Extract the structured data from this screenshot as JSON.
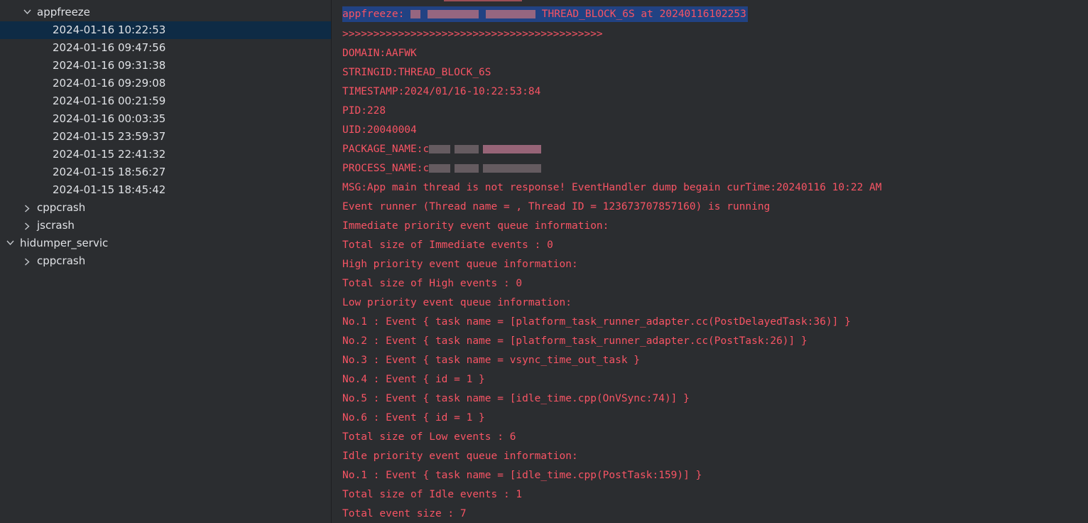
{
  "tree": {
    "partial_top_label": "…",
    "folder": "appfreeze",
    "entries": [
      "2024-01-16 10:22:53",
      "2024-01-16 09:47:56",
      "2024-01-16 09:31:38",
      "2024-01-16 09:29:08",
      "2024-01-16 00:21:59",
      "2024-01-16 00:03:35",
      "2024-01-15 23:59:37",
      "2024-01-15 22:41:32",
      "2024-01-15 18:56:27",
      "2024-01-15 18:45:42"
    ],
    "siblings": [
      "cppcrash",
      "jscrash"
    ],
    "root2": "hidumper_servic",
    "root2_children": [
      "cppcrash"
    ]
  },
  "log": {
    "header_prefix": "appfreeze: ",
    "header_suffix": " THREAD_BLOCK_6S at 20240116102253",
    "separator": ">>>>>>>>>>>>>>>>>>>>>>>>>>>>>>>>>>>>>>>>>>",
    "domain": "DOMAIN:AAFWK",
    "stringid": "STRINGID:THREAD_BLOCK_6S",
    "timestamp": "TIMESTAMP:2024/01/16-10:22:53:84",
    "pid": "PID:228",
    "uid": "UID:20040004",
    "package_name": "PACKAGE_NAME:c",
    "process_name": "PROCESS_NAME:c",
    "lines": [
      "MSG:App main thread is not response! EventHandler dump begain curTime:20240116 10:22 AM",
      "Event runner (Thread name = , Thread ID = 123673707857160) is running",
      "Immediate priority event queue information:",
      "Total size of Immediate events : 0",
      "High priority event queue information:",
      "Total size of High events : 0",
      "Low priority event queue information:",
      "No.1 : Event { task name = [platform_task_runner_adapter.cc(PostDelayedTask:36)] }",
      "No.2 : Event { task name = [platform_task_runner_adapter.cc(PostTask:26)] }",
      "No.3 : Event { task name = vsync_time_out_task }",
      "No.4 : Event { id = 1 }",
      "No.5 : Event { task name = [idle_time.cpp(OnVSync:74)] }",
      "No.6 : Event { id = 1 }",
      "Total size of Low events : 6",
      "Idle priority event queue information:",
      "No.1 : Event { task name = [idle_time.cpp(PostTask:159)] }",
      "Total size of Idle events : 1",
      "Total event size : 7"
    ]
  },
  "colors": {
    "panel_bg": "#2b2d30",
    "selection_bg": "#0e2b45",
    "log_text": "#f75464",
    "header_highlight": "#214283",
    "tree_text": "#dfe1e5"
  }
}
